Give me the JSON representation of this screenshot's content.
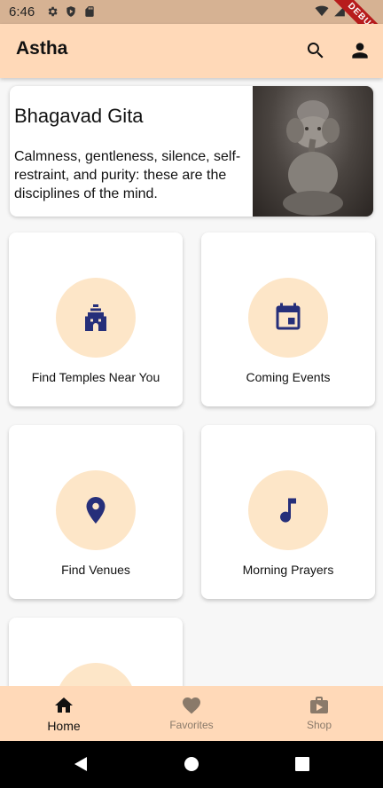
{
  "status_bar": {
    "time": "6:46"
  },
  "debug_banner": "DEBUG",
  "app_bar": {
    "title": "Astha"
  },
  "quote": {
    "title": "Bhagavad Gita",
    "text": "Calmness, gentleness, silence, self-restraint, and purity: these are the disciplines of the mind."
  },
  "tiles": [
    {
      "label": "Find Temples Near You",
      "icon": "temple-icon"
    },
    {
      "label": "Coming Events",
      "icon": "calendar-icon"
    },
    {
      "label": "Find Venues",
      "icon": "location-pin-icon"
    },
    {
      "label": "Morning Prayers",
      "icon": "music-note-icon"
    }
  ],
  "bottom_nav": {
    "items": [
      {
        "label": "Home",
        "icon": "home-icon",
        "active": true
      },
      {
        "label": "Favorites",
        "icon": "heart-icon",
        "active": false
      },
      {
        "label": "Shop",
        "icon": "shopping-bag-icon",
        "active": false
      }
    ]
  },
  "colors": {
    "app_bar": "#ffd9b8",
    "icon": "#262f7a",
    "icon_circle": "#fde6c8",
    "status_bar": "#d6b293"
  }
}
